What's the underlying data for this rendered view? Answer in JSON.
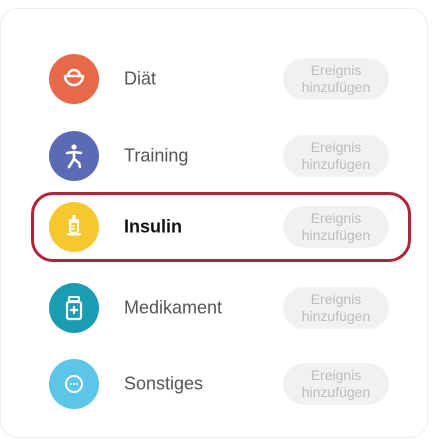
{
  "colors": {
    "diaet": "#e8694a",
    "training": "#5b6bb3",
    "insulin": "#f4c82e",
    "medikament": "#1a9db3",
    "sonstiges": "#5cc6e8",
    "selected_border": "#b0233a"
  },
  "items": [
    {
      "label": "Diät",
      "icon": "bowl-icon",
      "action": "Ereignis\nhinzufügen"
    },
    {
      "label": "Training",
      "icon": "runner-icon",
      "action": "Ereignis\nhinzufügen"
    },
    {
      "label": "Insulin",
      "icon": "syringe-icon",
      "action": "Ereignis\nhinzufügen"
    },
    {
      "label": "Medikament",
      "icon": "pill-bottle-icon",
      "action": "Ereignis\nhinzufügen"
    },
    {
      "label": "Sonstiges",
      "icon": "chat-bubble-icon",
      "action": "Ereignis\nhinzufügen"
    }
  ],
  "selected_index": 2
}
